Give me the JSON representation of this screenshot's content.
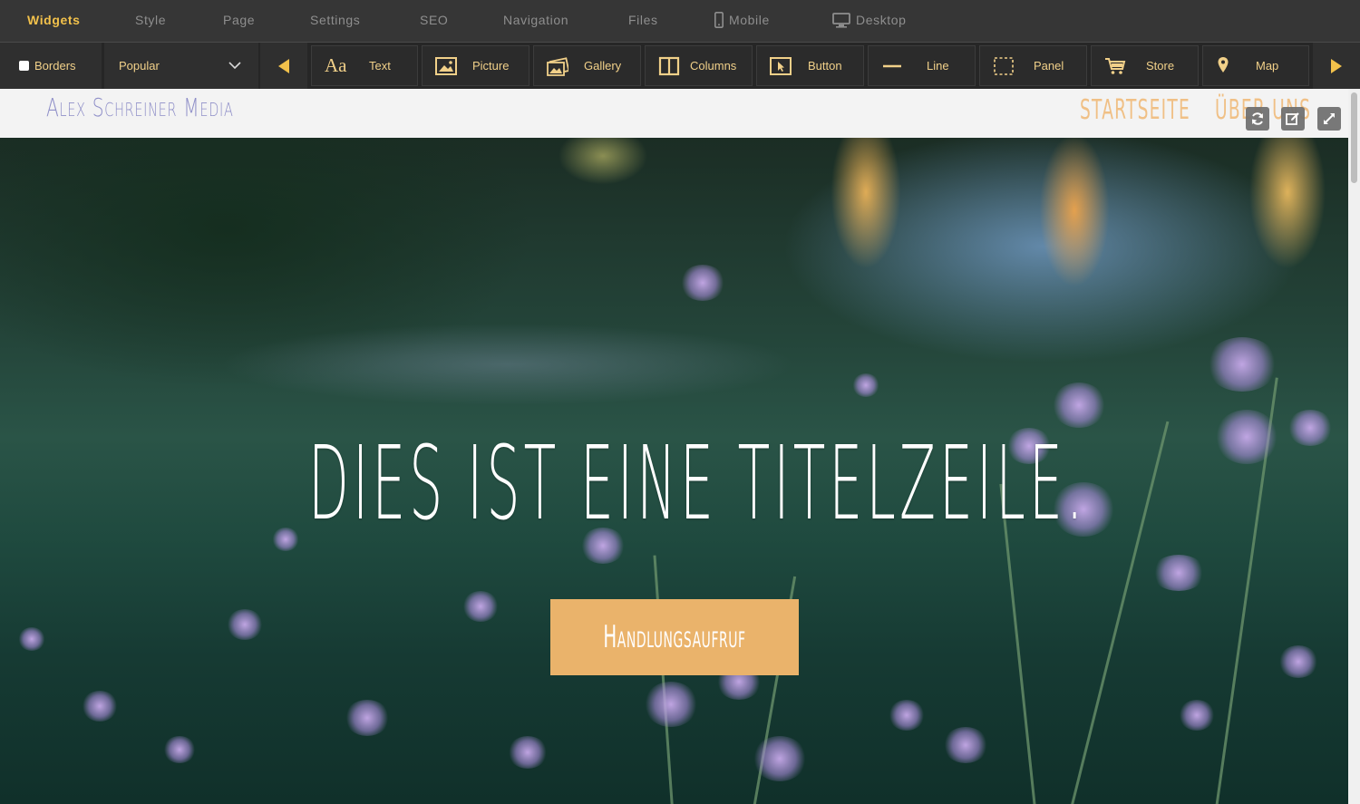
{
  "top_menu": {
    "items": [
      {
        "label": "Widgets",
        "active": true
      },
      {
        "label": "Style"
      },
      {
        "label": "Page"
      },
      {
        "label": "Settings"
      },
      {
        "label": "SEO"
      },
      {
        "label": "Navigation"
      },
      {
        "label": "Files"
      },
      {
        "label": "Mobile",
        "icon": "phone-icon"
      },
      {
        "label": "Desktop",
        "icon": "monitor-icon"
      }
    ]
  },
  "toolbar": {
    "borders_label": "Borders",
    "borders_checked": false,
    "category_selected": "Popular",
    "widgets": [
      {
        "label": "Text",
        "icon": "text-icon"
      },
      {
        "label": "Picture",
        "icon": "picture-icon"
      },
      {
        "label": "Gallery",
        "icon": "gallery-icon"
      },
      {
        "label": "Columns",
        "icon": "columns-icon"
      },
      {
        "label": "Button",
        "icon": "cursor-button-icon"
      },
      {
        "label": "Line",
        "icon": "line-icon"
      },
      {
        "label": "Panel",
        "icon": "panel-icon"
      },
      {
        "label": "Store",
        "icon": "cart-icon"
      },
      {
        "label": "Map",
        "icon": "map-pin-icon"
      }
    ],
    "text_icon_glyph": "Aa"
  },
  "site": {
    "brand": "Alex Schreiner Media",
    "nav": [
      "Startseite",
      "Über uns"
    ]
  },
  "hero": {
    "headline": "Dies ist eine Titelzeile.",
    "cta_label": "Handlungsaufruf"
  },
  "colors": {
    "accent": "#f2c14b",
    "toolbar_text": "#f1d089",
    "brand": "#8f8fc8",
    "nav": "#f0c086",
    "cta": "#eab36b"
  }
}
